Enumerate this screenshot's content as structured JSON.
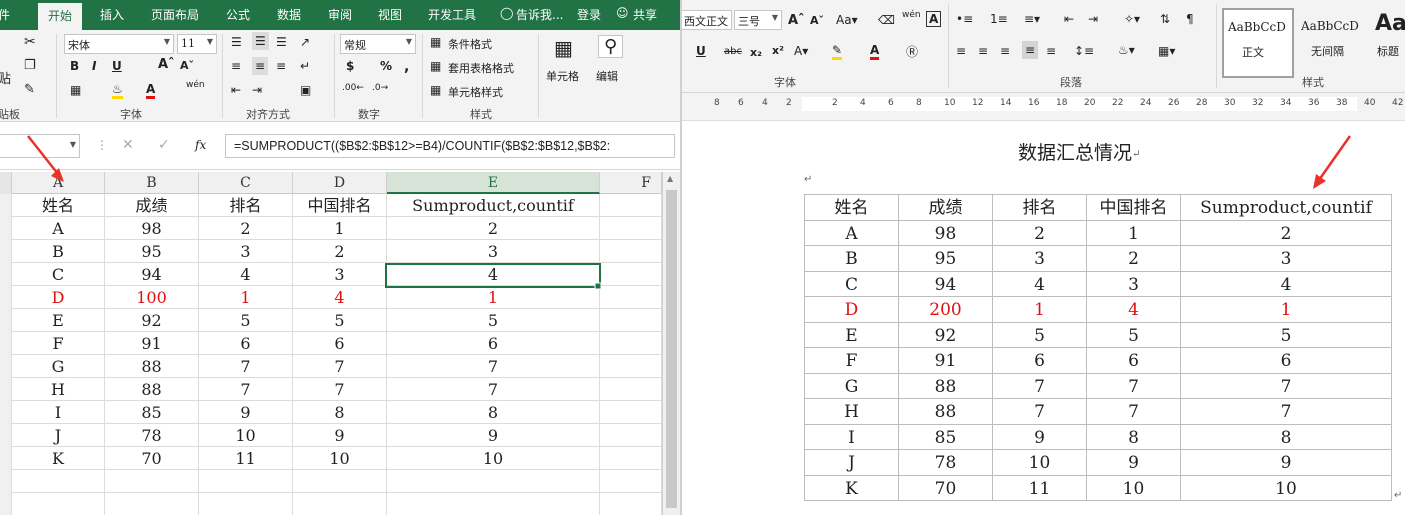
{
  "excel": {
    "tabs": [
      "件",
      "开始",
      "插入",
      "页面布局",
      "公式",
      "数据",
      "审阅",
      "视图",
      "开发工具"
    ],
    "tell_me": "告诉我...",
    "login": "登录",
    "share": "共享",
    "font": {
      "name": "宋体",
      "size": "11"
    },
    "number_format": "常规",
    "group_labels": {
      "clipboard": "贴板",
      "font": "字体",
      "alignment": "对齐方式",
      "number": "数字",
      "styles": "样式"
    },
    "paste_label": "贴",
    "styles_buttons": [
      "条件格式",
      "套用表格格式",
      "单元格样式"
    ],
    "cells_label": "单元格",
    "editing_label": "编辑",
    "wen_glyph": "wén",
    "formula": "=SUMPRODUCT(($B$2:$B$12>=B4)/COUNTIF($B$2:$B$12,$B$2:",
    "fx": "fx",
    "columns": [
      "A",
      "B",
      "C",
      "D",
      "E",
      "F"
    ],
    "headers": [
      "姓名",
      "成绩",
      "排名",
      "中国排名",
      "Sumproduct,countif"
    ],
    "rows": [
      [
        "A",
        "98",
        "2",
        "1",
        "2"
      ],
      [
        "B",
        "95",
        "3",
        "2",
        "3"
      ],
      [
        "C",
        "94",
        "4",
        "3",
        "4"
      ],
      [
        "D",
        "100",
        "1",
        "4",
        "1"
      ],
      [
        "E",
        "92",
        "5",
        "5",
        "5"
      ],
      [
        "F",
        "91",
        "6",
        "6",
        "6"
      ],
      [
        "G",
        "88",
        "7",
        "7",
        "7"
      ],
      [
        "H",
        "88",
        "7",
        "7",
        "7"
      ],
      [
        "I",
        "85",
        "9",
        "8",
        "8"
      ],
      [
        "J",
        "78",
        "10",
        "9",
        "9"
      ],
      [
        "K",
        "70",
        "11",
        "10",
        "10"
      ]
    ],
    "highlight_row_index": 3,
    "highlight_color": "#e01010",
    "accent_color": "#217346"
  },
  "word": {
    "font": {
      "name": "西文正文",
      "size": "三号"
    },
    "group_labels": {
      "font": "字体",
      "paragraph": "段落",
      "styles": "样式"
    },
    "wen_glyph": "wén",
    "styles": [
      {
        "preview": "AaBbCcD",
        "name": "正文"
      },
      {
        "preview": "AaBbCcD",
        "name": "无间隔"
      },
      {
        "preview": "Aa",
        "name": "标题"
      }
    ],
    "ruler_numbers": [
      "8",
      "6",
      "4",
      "2",
      "",
      "2",
      "4",
      "6",
      "8",
      "10",
      "12",
      "14",
      "16",
      "18",
      "20",
      "22",
      "24",
      "26",
      "28",
      "30",
      "32",
      "34",
      "36",
      "38",
      "40",
      "42"
    ],
    "doc_title": "数据汇总情况",
    "paragraph_mark": "↵",
    "headers": [
      "姓名",
      "成绩",
      "排名",
      "中国排名",
      "Sumproduct,countif"
    ],
    "rows": [
      [
        "A",
        "98",
        "2",
        "1",
        "2"
      ],
      [
        "B",
        "95",
        "3",
        "2",
        "3"
      ],
      [
        "C",
        "94",
        "4",
        "3",
        "4"
      ],
      [
        "D",
        "200",
        "1",
        "4",
        "1"
      ],
      [
        "E",
        "92",
        "5",
        "5",
        "5"
      ],
      [
        "F",
        "91",
        "6",
        "6",
        "6"
      ],
      [
        "G",
        "88",
        "7",
        "7",
        "7"
      ],
      [
        "H",
        "88",
        "7",
        "7",
        "7"
      ],
      [
        "I",
        "85",
        "9",
        "8",
        "8"
      ],
      [
        "J",
        "78",
        "10",
        "9",
        "9"
      ],
      [
        "K",
        "70",
        "11",
        "10",
        "10"
      ]
    ],
    "highlight_row_index": 3,
    "highlight_color": "#e01010"
  },
  "annotation_arrow_color": "#e8322b"
}
